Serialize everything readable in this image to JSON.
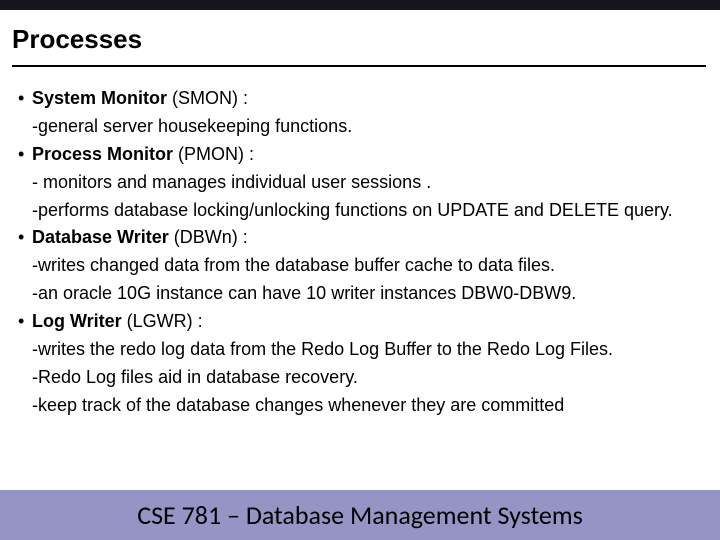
{
  "title": "Processes",
  "bullets": [
    {
      "head_bold": "System Monitor",
      "head_rest": " (SMON) :",
      "lines": [
        "-general server housekeeping functions."
      ]
    },
    {
      "head_bold": "Process Monitor",
      "head_rest": " (PMON) :",
      "lines": [
        "- monitors and manages individual user sessions .",
        "-performs database locking/unlocking functions on UPDATE and DELETE query."
      ]
    },
    {
      "head_bold": "Database Writer",
      "head_rest": " (DBWn) :",
      "lines": [
        "-writes changed data from the database buffer cache to data files.",
        "-an oracle 10G instance can have 10 writer instances DBW0-DBW9."
      ]
    },
    {
      "head_bold": "Log Writer",
      "head_rest": " (LGWR) :",
      "lines": [
        "-writes the redo log data from the Redo Log Buffer to the Redo Log Files.",
        "-Redo Log files aid in database recovery.",
        "-keep track of the database changes whenever they are committed"
      ]
    }
  ],
  "footer": "CSE 781 – Database Management Systems",
  "bullet_char": "• "
}
